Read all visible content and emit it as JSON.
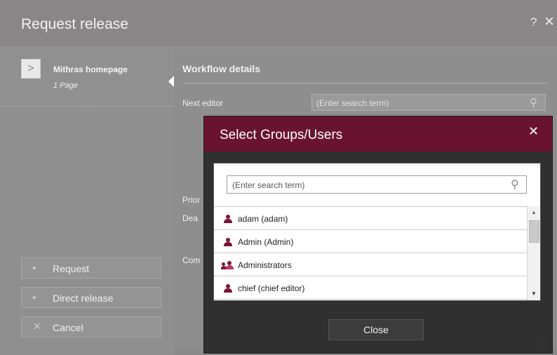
{
  "window": {
    "title": "Request release",
    "help_label": "?",
    "close_label": "✕"
  },
  "sidebar": {
    "arrow_label": ">",
    "item_title": "Mithras homepage",
    "item_subtitle": "1 Page",
    "buttons": [
      {
        "icon": "play-icon",
        "glyph": "▸",
        "label": "Request"
      },
      {
        "icon": "play-icon",
        "glyph": "▸",
        "label": "Direct release"
      },
      {
        "icon": "cancel-x-icon",
        "glyph": "✕",
        "label": "Cancel"
      }
    ]
  },
  "workflow": {
    "heading": "Workflow details",
    "next_editor_label": "Next editor",
    "next_editor_placeholder": "(Enter search term)",
    "priority_label_partial": "Prior",
    "deadline_label_partial": "Dea",
    "comment_label_partial": "Com"
  },
  "modal": {
    "title": "Select Groups/Users",
    "close_label": "✕",
    "search_placeholder": "(Enter search term)",
    "users": [
      {
        "type": "user",
        "label": "adam (adam)"
      },
      {
        "type": "user",
        "label": "Admin (Admin)"
      },
      {
        "type": "group",
        "label": "Administrators"
      },
      {
        "type": "user",
        "label": "chief (chief editor)"
      }
    ],
    "close_button_label": "Close"
  },
  "colors": {
    "modal_titlebar": "#6a1330",
    "user_icon": "#7b1636"
  }
}
